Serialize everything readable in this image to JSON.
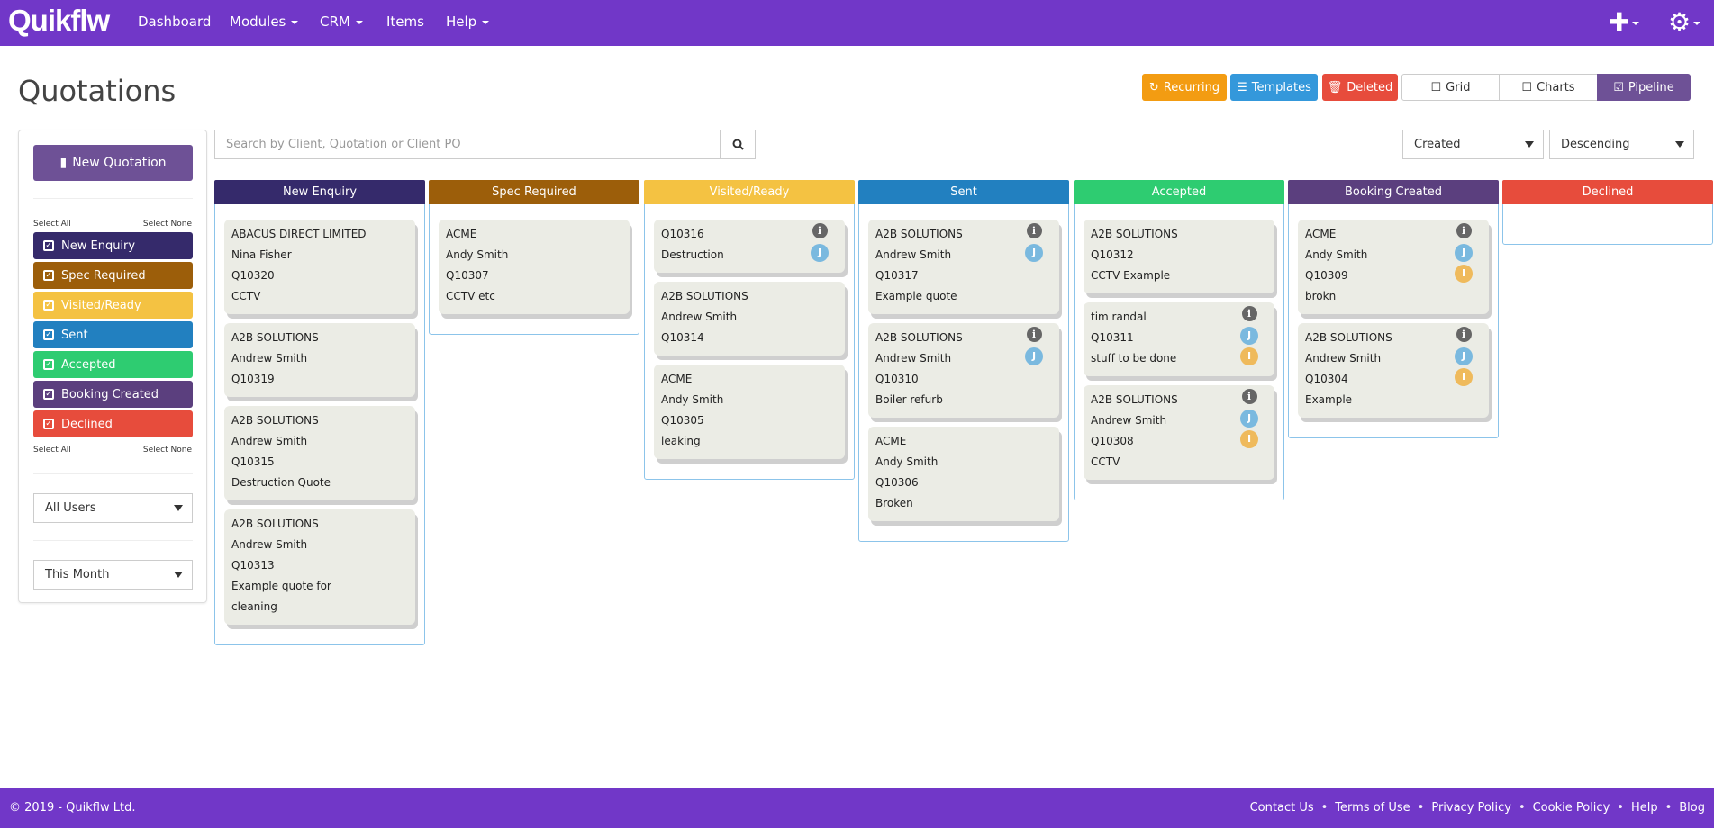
{
  "nav": {
    "logo": "Quikflw",
    "items": [
      "Dashboard",
      "Modules",
      "CRM",
      "Items",
      "Help"
    ],
    "dropdowns": [
      false,
      true,
      true,
      false,
      true
    ],
    "plus_icon": "plus-icon",
    "gear_icon": "gear-icon"
  },
  "page": {
    "title": "Quotations"
  },
  "toolbar": {
    "recurring": "Recurring",
    "templates": "Templates",
    "deleted": "Deleted",
    "grid": "Grid",
    "charts": "Charts",
    "pipeline": "Pipeline",
    "colors": {
      "recurring": "#f39c12",
      "templates": "#3498db",
      "deleted": "#e74c3c",
      "pipeline": "#6e5196"
    }
  },
  "sidebar": {
    "new_quotation": "New Quotation",
    "select_all": "Select All",
    "select_none": "Select None",
    "statuses": [
      {
        "label": "New Enquiry",
        "color": "#352a6b",
        "checked": true
      },
      {
        "label": "Spec Required",
        "color": "#9c5e0a",
        "checked": true
      },
      {
        "label": "Visited/Ready",
        "color": "#f4c242",
        "checked": true
      },
      {
        "label": "Sent",
        "color": "#2280c0",
        "checked": true
      },
      {
        "label": "Accepted",
        "color": "#2ecc71",
        "checked": true
      },
      {
        "label": "Booking Created",
        "color": "#5b3f7e",
        "checked": true
      },
      {
        "label": "Declined",
        "color": "#e74c3c",
        "checked": true
      }
    ],
    "users_filter": "All Users",
    "date_filter": "This Month"
  },
  "search": {
    "placeholder": "Search by Client, Quotation or Client PO",
    "value": ""
  },
  "sort": {
    "field": "Created",
    "order": "Descending"
  },
  "columns": [
    {
      "title": "New Enquiry",
      "color": "#352a6b",
      "cards": [
        {
          "lines": [
            "ABACUS DIRECT LIMITED",
            "Nina Fisher",
            "Q10320",
            "CCTV"
          ],
          "info": false,
          "badges": []
        },
        {
          "lines": [
            "A2B SOLUTIONS",
            "Andrew Smith",
            "Q10319"
          ],
          "info": false,
          "badges": []
        },
        {
          "lines": [
            "A2B SOLUTIONS",
            "Andrew Smith",
            "Q10315",
            "Destruction Quote"
          ],
          "info": false,
          "badges": []
        },
        {
          "lines": [
            "A2B SOLUTIONS",
            "Andrew Smith",
            "Q10313",
            "Example quote for",
            "cleaning"
          ],
          "info": false,
          "badges": []
        }
      ]
    },
    {
      "title": "Spec Required",
      "color": "#9c5e0a",
      "cards": [
        {
          "lines": [
            "ACME",
            "Andy Smith",
            "Q10307",
            "CCTV etc"
          ],
          "info": false,
          "badges": []
        }
      ]
    },
    {
      "title": "Visited/Ready",
      "color": "#f4c242",
      "cards": [
        {
          "lines": [
            "Q10316",
            "Destruction"
          ],
          "info": true,
          "badges": [
            "J"
          ]
        },
        {
          "lines": [
            "A2B SOLUTIONS",
            "Andrew Smith",
            "Q10314"
          ],
          "info": false,
          "badges": []
        },
        {
          "lines": [
            "ACME",
            "Andy Smith",
            "Q10305",
            "leaking"
          ],
          "info": false,
          "badges": []
        }
      ]
    },
    {
      "title": "Sent",
      "color": "#2280c0",
      "cards": [
        {
          "lines": [
            "A2B SOLUTIONS",
            "Andrew Smith",
            "Q10317",
            "Example quote"
          ],
          "info": true,
          "badges": [
            "J"
          ]
        },
        {
          "lines": [
            "A2B SOLUTIONS",
            "Andrew Smith",
            "Q10310",
            "Boiler refurb"
          ],
          "info": true,
          "badges": [
            "J"
          ]
        },
        {
          "lines": [
            "ACME",
            "Andy Smith",
            "Q10306",
            "Broken"
          ],
          "info": false,
          "badges": []
        }
      ]
    },
    {
      "title": "Accepted",
      "color": "#2ecc71",
      "cards": [
        {
          "lines": [
            "A2B SOLUTIONS",
            "Q10312",
            "CCTV Example"
          ],
          "info": false,
          "badges": []
        },
        {
          "lines": [
            "tim randal",
            "Q10311",
            "stuff to be done"
          ],
          "info": true,
          "badges": [
            "J",
            "I"
          ]
        },
        {
          "lines": [
            "A2B SOLUTIONS",
            "Andrew Smith",
            "Q10308",
            "CCTV"
          ],
          "info": true,
          "badges": [
            "J",
            "I"
          ]
        }
      ]
    },
    {
      "title": "Booking Created",
      "color": "#5b3f7e",
      "cards": [
        {
          "lines": [
            "ACME",
            "Andy Smith",
            "Q10309",
            "brokn"
          ],
          "info": true,
          "badges": [
            "J",
            "I"
          ]
        },
        {
          "lines": [
            "A2B SOLUTIONS",
            "Andrew Smith",
            "Q10304",
            "Example"
          ],
          "info": true,
          "badges": [
            "J",
            "I"
          ]
        }
      ]
    },
    {
      "title": "Declined",
      "color": "#e74c3c",
      "cards": []
    }
  ],
  "footer": {
    "copyright": "© 2019 - Quikflw Ltd.",
    "links": [
      "Contact Us",
      "Terms of Use",
      "Privacy Policy",
      "Cookie Policy",
      "Help",
      "Blog"
    ]
  }
}
